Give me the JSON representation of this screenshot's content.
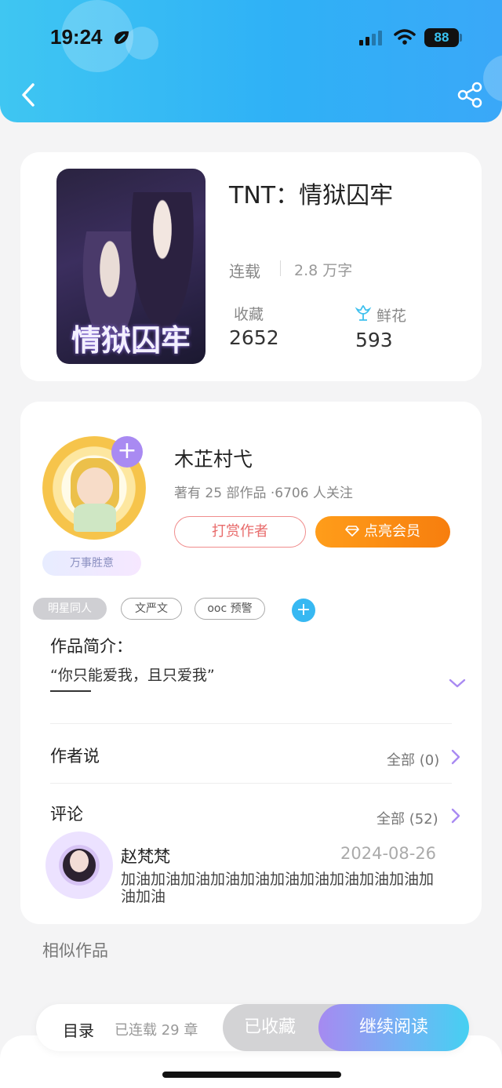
{
  "status_bar": {
    "time": "19:24",
    "battery": "88"
  },
  "header": {
    "back_icon": "chevron-left-icon",
    "share_icon": "share-icon"
  },
  "book": {
    "cover_title": "情狱囚牢",
    "title": "TNT：情狱囚牢",
    "status": "连载",
    "word_count": "2.8 万字",
    "collect_label": "收藏",
    "collect_value": "2652",
    "flower_label": "鲜花",
    "flower_value": "593"
  },
  "author": {
    "name": "木芷村弋",
    "meta": "著有 25 部作品 ·6706 人关注",
    "motto": "万事胜意",
    "follow_symbol": "+",
    "tip_label": "打赏作者",
    "vip_label": "点亮会员"
  },
  "tags": [
    "明星同人",
    "文严文",
    "ooc 预警"
  ],
  "add_tag_symbol": "+",
  "intro": {
    "title": "作品简介：",
    "text": "“你只能爱我，且只爱我”"
  },
  "author_says": {
    "title": "作者说",
    "see_all": "全部 (0)"
  },
  "comments": {
    "title": "评论",
    "see_all": "全部 (52)",
    "items": [
      {
        "user": "赵梵梵",
        "date": "2024-08-26",
        "text": "加油加油加油加油加油加油加油加油加油加油加油加油"
      }
    ]
  },
  "similar_label": "相似作品",
  "bottom_bar": {
    "toc_label": "目录",
    "toc_count": "已连载 29 章",
    "fav_label": "已收藏",
    "read_label": "继续阅读"
  },
  "colors": {
    "header_start": "#3fc6f2",
    "header_end": "#3aa8f8",
    "vip_orange": "#f77e0e",
    "follow_purple": "#a98af2",
    "accent_blue": "#37b8f2"
  }
}
